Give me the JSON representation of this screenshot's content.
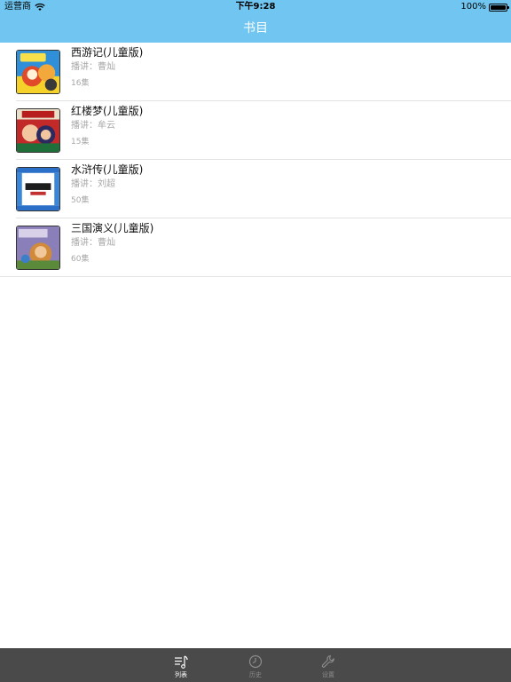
{
  "status_bar": {
    "carrier": "运营商",
    "time": "下午9:28",
    "battery": "100%"
  },
  "nav": {
    "title": "书目"
  },
  "books": [
    {
      "title": "西游记(儿童版)",
      "narrator": "播讲：曹灿",
      "episodes": "16集"
    },
    {
      "title": "红楼梦(儿童版)",
      "narrator": "播讲：牟云",
      "episodes": "15集"
    },
    {
      "title": "水浒传(儿童版)",
      "narrator": "播讲：刘超",
      "episodes": "50集"
    },
    {
      "title": "三国演义(儿童版)",
      "narrator": "播讲：曹灿",
      "episodes": "60集"
    }
  ],
  "tabs": [
    {
      "label": "列表",
      "icon": "music-list-icon",
      "active": true
    },
    {
      "label": "历史",
      "icon": "clock-icon",
      "active": false
    },
    {
      "label": "设置",
      "icon": "wrench-icon",
      "active": false
    }
  ],
  "colors": {
    "nav_background": "#70c6f0",
    "tabbar_background": "#4a4a4a",
    "subtext": "#a7a7a7"
  }
}
